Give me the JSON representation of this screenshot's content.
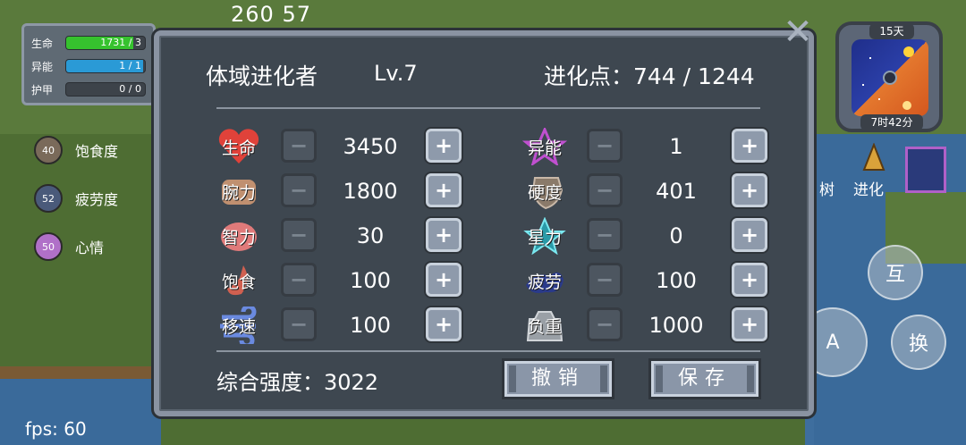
{
  "hud": {
    "top_numbers": "260   57",
    "fps": "fps: 60",
    "stats": [
      {
        "label": "生命",
        "value": "1731 / 3",
        "fill": 0.85,
        "color": "#36c22e"
      },
      {
        "label": "异能",
        "value": "1 / 1",
        "fill": 0.98,
        "color": "#2a9ad6"
      },
      {
        "label": "护甲",
        "value": "0 / 0",
        "fill": 0.0,
        "color": "#888888"
      }
    ],
    "needs": [
      {
        "label": "饱食度",
        "value": "40",
        "color": "#7a6a5a"
      },
      {
        "label": "疲劳度",
        "value": "52",
        "color": "#4a5a7a"
      },
      {
        "label": "心情",
        "value": "50",
        "color": "#b070c8"
      }
    ]
  },
  "clock": {
    "day": "15天",
    "time": "7时42分"
  },
  "side": {
    "tree_label": "树",
    "evolve_label": "进化",
    "interact": "互",
    "attack": "A",
    "swap": "换"
  },
  "panel": {
    "title": "体域进化者",
    "level": "Lv.7",
    "points_label": "进化点：744 / 1244",
    "left_stats": [
      {
        "name": "生命",
        "value": "3450",
        "icon": "heart-icon",
        "color": "#e0423a"
      },
      {
        "name": "腕力",
        "value": "1800",
        "icon": "fist-icon",
        "color": "#c09070"
      },
      {
        "name": "智力",
        "value": "30",
        "icon": "brain-icon",
        "color": "#e07a7a"
      },
      {
        "name": "饱食",
        "value": "100",
        "icon": "stomach-icon",
        "color": "#d06050"
      },
      {
        "name": "移速",
        "value": "100",
        "icon": "wind-icon",
        "color": "#6a8ae0"
      }
    ],
    "right_stats": [
      {
        "name": "异能",
        "value": "1",
        "icon": "star-icon",
        "color": "#c050d0"
      },
      {
        "name": "硬度",
        "value": "401",
        "icon": "shield-icon",
        "color": "#8a7a6a"
      },
      {
        "name": "星力",
        "value": "0",
        "icon": "star-crystal-icon",
        "color": "#3ac0c8"
      },
      {
        "name": "疲劳",
        "value": "100",
        "icon": "fatigue-icon",
        "color": "#2a3a8a"
      },
      {
        "name": "负重",
        "value": "1000",
        "icon": "weight-icon",
        "color": "#9aa0a6"
      }
    ],
    "total_label": "综合强度：3022",
    "cancel_label": "撤销",
    "save_label": "保存",
    "minus": "−",
    "plus": "+"
  }
}
